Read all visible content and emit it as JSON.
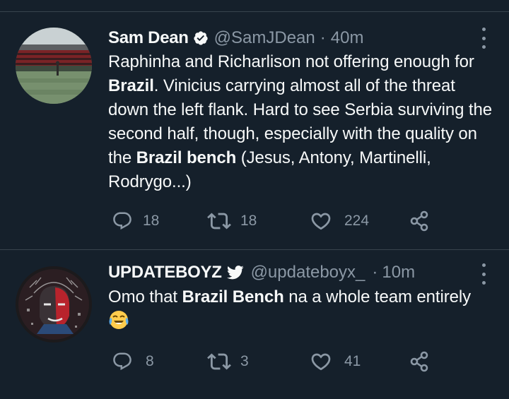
{
  "tweets": [
    {
      "name": "Sam Dean",
      "verified": true,
      "handle": "@SamJDean",
      "separator": "·",
      "time": "40m",
      "text_parts": [
        {
          "t": "Raphinha and Richarlison not offering enough for ",
          "b": false
        },
        {
          "t": "Brazil",
          "b": true
        },
        {
          "t": ". Vinicius carrying almost all of the threat down the left flank. Hard to see Serbia surviving the second half, though, especially with the quality on the ",
          "b": false
        },
        {
          "t": "Brazil bench",
          "b": true
        },
        {
          "t": " (Jesus, Antony, Martinelli, Rodrygo...)",
          "b": false
        }
      ],
      "replies": "18",
      "retweets": "18",
      "likes": "224"
    },
    {
      "name": "UPDATEBOYZ",
      "verified": false,
      "handle": "@updateboyx_",
      "separator": "·",
      "time": "10m",
      "text_parts": [
        {
          "t": "Omo that ",
          "b": false
        },
        {
          "t": "Brazil Bench",
          "b": true
        },
        {
          "t": " na a whole team entirely",
          "b": false
        }
      ],
      "emoji": "face-with-tears-of-joy",
      "replies": "8",
      "retweets": "3",
      "likes": "41"
    }
  ],
  "colors": {
    "background": "#15202b",
    "divider": "#38444d",
    "primary_text": "#f7f9f9",
    "secondary_text": "#8b98a5",
    "verified_badge": "#f7f9f9"
  },
  "icons": [
    "verified-badge-icon",
    "twitter-bird-icon",
    "more-options-icon",
    "reply-icon",
    "retweet-icon",
    "like-icon",
    "share-icon"
  ]
}
